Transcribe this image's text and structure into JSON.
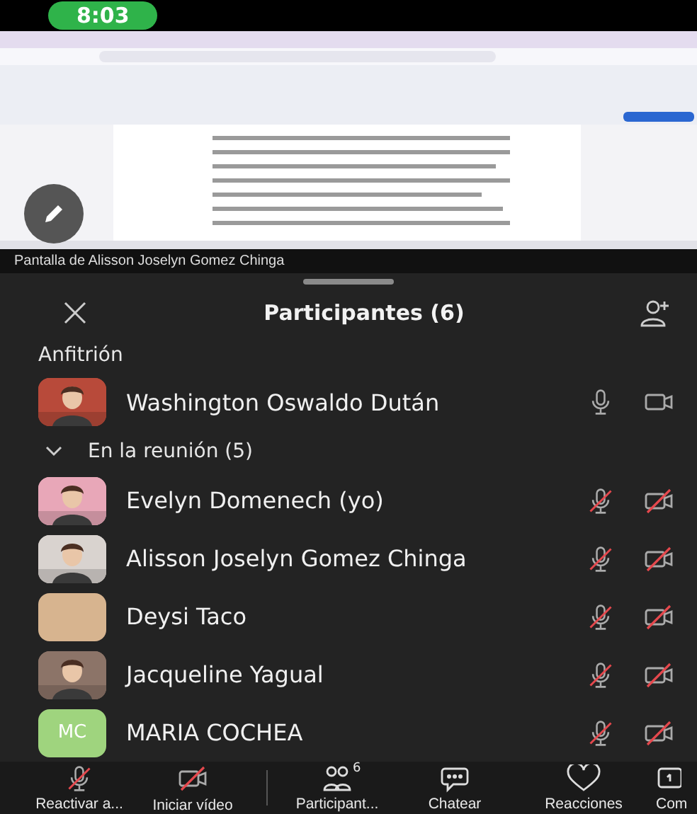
{
  "status_bar": {
    "time": "8:03"
  },
  "shared_screen": {
    "kind": "picture",
    "caption": "Pantalla de Alisson Joselyn Gomez Chinga"
  },
  "panel": {
    "title": "Participantes (6)",
    "host_section": {
      "label": "Anfitrión",
      "participants": [
        {
          "name": "Washington Oswaldo Dután",
          "mic_muted": false,
          "video_off": false
        }
      ]
    },
    "meeting_section": {
      "label": "En la reunión (5)",
      "expanded": true,
      "participants": [
        {
          "name": "Evelyn Domenech (yo)",
          "mic_muted": true,
          "video_off": true
        },
        {
          "name": "Alisson Joselyn Gomez Chinga",
          "mic_muted": true,
          "video_off": true
        },
        {
          "name": "Deysi Taco",
          "avatar": {
            "kind": "plain",
            "color": "#d7b48f"
          },
          "mic_muted": true,
          "video_off": true
        },
        {
          "name": "Jacqueline Yagual",
          "mic_muted": true,
          "video_off": true
        },
        {
          "name": "MARIA COCHEA",
          "avatar": {
            "kind": "initials",
            "initials": "MC",
            "color": "#9fd47e"
          },
          "mic_muted": true,
          "video_off": true
        }
      ]
    }
  },
  "toolbar": [
    {
      "kind": "mic",
      "label": "Reactivar a...",
      "off": true
    },
    {
      "kind": "video",
      "label": "Iniciar vídeo",
      "off": true
    },
    {
      "kind": "participants",
      "label": "Participant...",
      "badge": "6"
    },
    {
      "kind": "chat",
      "label": "Chatear"
    },
    {
      "kind": "reactions",
      "label": "Reacciones"
    },
    {
      "kind": "share",
      "label": "Com"
    }
  ]
}
